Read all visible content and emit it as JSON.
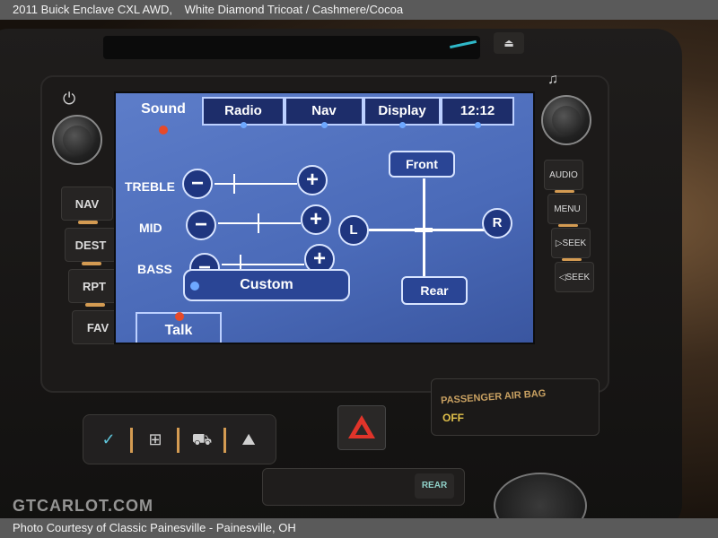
{
  "caption": {
    "title": "2011 Buick Enclave CXL AWD,",
    "color": "White Diamond Tricoat / Cashmere/Cocoa",
    "footer": "Photo Courtesy of Classic Painesville - Painesville, OH",
    "watermark": "GTCARLOT.COM"
  },
  "screen": {
    "tabs": [
      {
        "label": "Sound",
        "active": true
      },
      {
        "label": "Radio"
      },
      {
        "label": "Nav"
      },
      {
        "label": "Display"
      },
      {
        "label": "12:12"
      }
    ],
    "eq": [
      {
        "label": "TREBLE",
        "minus": "−",
        "plus": "+"
      },
      {
        "label": "MID",
        "minus": "−",
        "plus": "+"
      },
      {
        "label": "BASS",
        "minus": "−",
        "plus": "+"
      }
    ],
    "custom_label": "Custom",
    "talk_label": "Talk",
    "fade": {
      "front": "Front",
      "rear": "Rear",
      "left": "L",
      "right": "R"
    }
  },
  "left_buttons": [
    "NAV",
    "DEST",
    "RPT",
    "FAV"
  ],
  "right_buttons": [
    "AUDIO",
    "MENU",
    "▷SEEK",
    "◁SEEK"
  ],
  "airbag": {
    "label": "PASSENGER AIR BAG",
    "status": "OFF"
  },
  "rear_button": "REAR",
  "eject_glyph": "⏏",
  "music_glyph": "♫",
  "power_glyph": "⏻",
  "colors": {
    "screen_blue": "#4a6ab8",
    "accent_orange": "#d49b52",
    "hazard_red": "#e0342a"
  }
}
